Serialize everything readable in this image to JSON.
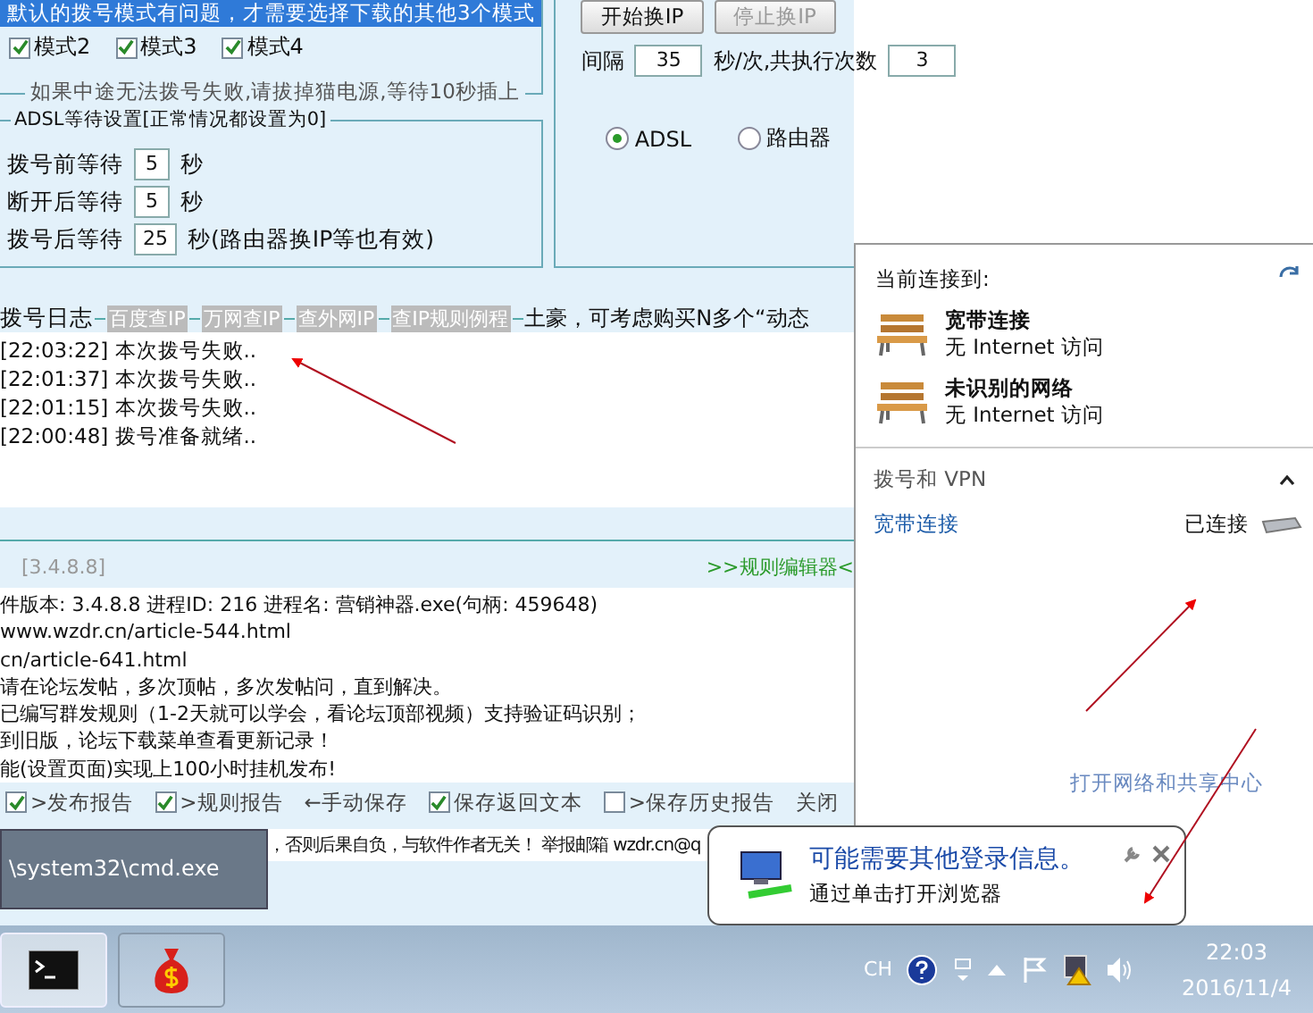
{
  "app": {
    "mode_hint": "默认的拨号模式有问题，才需要选择下载的其他3个模式",
    "modes": [
      {
        "label": "模式2",
        "checked": true
      },
      {
        "label": "模式3",
        "checked": true
      },
      {
        "label": "模式4",
        "checked": true
      }
    ],
    "mode_note": "如果中途无法拨号失败,请拔掉猫电源,等待10秒插上",
    "adsl_wait": {
      "title": "ADSL等待设置[正常情况都设置为0]",
      "rows": [
        {
          "label": "拨号前等待",
          "value": "5",
          "unit": "秒"
        },
        {
          "label": "断开后等待",
          "value": "5",
          "unit": "秒"
        },
        {
          "label": "拨号后等待",
          "value": "25",
          "unit": "秒(路由器换IP等也有效)"
        }
      ]
    },
    "switch_ip": {
      "buttons": [
        {
          "label": "开始换IP",
          "disabled": false
        },
        {
          "label": "停止换IP",
          "disabled": true
        }
      ],
      "interval_label": "间隔",
      "interval": "35",
      "per_label": "秒/次,共执行次数",
      "count": "3",
      "radios": [
        {
          "label": "ADSL",
          "selected": true
        },
        {
          "label": "路由器",
          "selected": false
        }
      ]
    },
    "log": {
      "title": "拨号日志",
      "links": [
        "百度查IP",
        "万网查IP",
        "查外网IP",
        "查IP规则例程"
      ],
      "promo": "土豪，可考虑购买N多个“动态",
      "lines": [
        "[22:03:22] 本次拨号失败..",
        "[22:01:37] 本次拨号失败..",
        "[22:01:15] 本次拨号失败..",
        "[22:00:48] 拨号准备就绪.."
      ]
    },
    "version": "[3.4.8.8]",
    "rule_editor": ">>规则编辑器<",
    "info_lines": [
      "件版本: 3.4.8.8 进程ID: 216 进程名: 营销神器.exe(句柄: 459648)",
      " www.wzdr.cn/article-544.html",
      "cn/article-641.html",
      "请在论坛发帖，多次顶帖，多次发帖问，直到解决。",
      "已编写群发规则（1-2天就可以学会，看论坛顶部视频）支持验证码识别；",
      "到旧版，论坛下载菜单查看更新记录！",
      "能(设置页面)实现上100小时挂机发布!"
    ],
    "options": [
      {
        "kind": "checkbox",
        "label": ">发布报告",
        "checked": true
      },
      {
        "kind": "checkbox",
        "label": ">规则报告",
        "checked": true
      },
      {
        "kind": "action",
        "label": "←手动保存"
      },
      {
        "kind": "checkbox",
        "label": "保存返回文本",
        "checked": true
      },
      {
        "kind": "checkbox",
        "label": ">保存历史报告",
        "checked": false
      },
      {
        "kind": "action",
        "label": "关闭"
      }
    ],
    "notice": "，否则后果自负，与软件作者无关！ 举报邮箱 wzdr.cn@q"
  },
  "tooltip": {
    "text": "\\system32\\cmd.exe"
  },
  "network_flyout": {
    "heading": "当前连接到:",
    "connections": [
      {
        "name": "宽带连接",
        "status": "无 Internet 访问"
      },
      {
        "name": "未识别的网络",
        "status": "无 Internet 访问"
      }
    ],
    "section": "拨号和 VPN",
    "expanded": true,
    "dialup": {
      "name": "宽带连接",
      "status": "已连接"
    },
    "footer_link": "打开网络和共享中心"
  },
  "balloon": {
    "title": "可能需要其他登录信息。",
    "text": "通过单击打开浏览器"
  },
  "taskbar": {
    "buttons": [
      {
        "kind": "terminal",
        "selected": true
      },
      {
        "kind": "moneybag",
        "selected": false
      }
    ],
    "language": "CH",
    "time": "22:03",
    "date": "2016/11/4"
  }
}
